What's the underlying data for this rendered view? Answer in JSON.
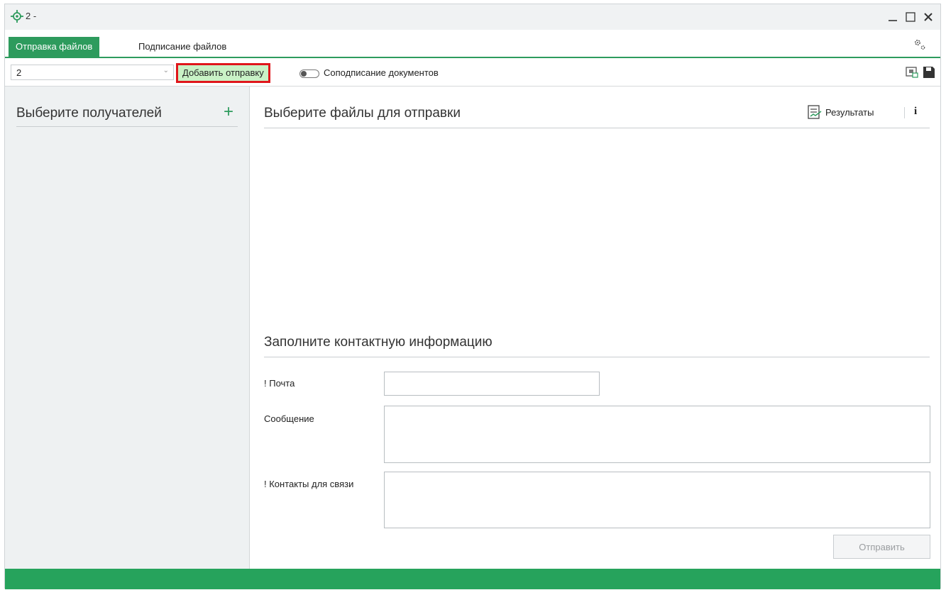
{
  "window": {
    "title": "2 -"
  },
  "tabs": [
    {
      "label": "Отправка файлов",
      "active": true
    },
    {
      "label": "Подписание файлов",
      "active": false
    }
  ],
  "toolbar": {
    "combo_value": "2",
    "add_button_label": "Добавить отправку",
    "cosign_label": "Соподписание документов"
  },
  "left_panel": {
    "title": "Выберите получателей"
  },
  "main": {
    "files_title": "Выберите файлы для отправки",
    "results_label": "Результаты",
    "info_label": "i",
    "contact_title": "Заполните контактную информацию",
    "email_label": "! Почта",
    "email_value": "",
    "message_label": "Сообщение",
    "message_value": "",
    "contacts_label": "! Контакты для связи",
    "contacts_value": "",
    "send_label": "Отправить"
  },
  "colors": {
    "accent": "#2d9b5d",
    "status_bar": "#26a35c",
    "highlight_border": "#e0161b",
    "highlight_fill": "#c9f2c6"
  }
}
